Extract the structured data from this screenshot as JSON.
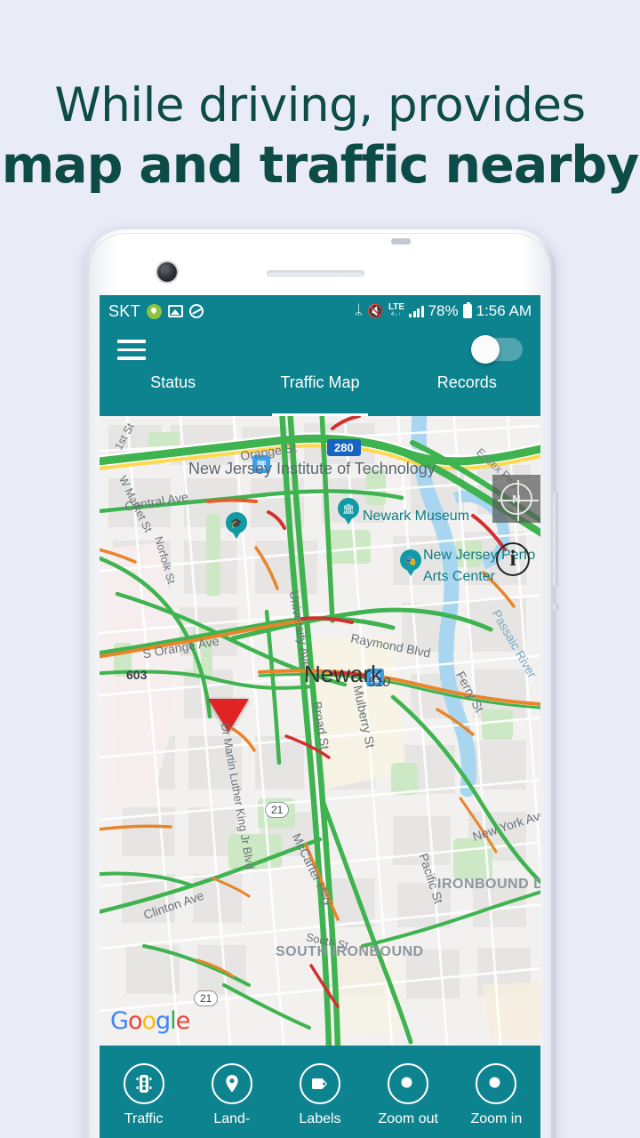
{
  "promo": {
    "line1": "While driving, provides",
    "line2": "map and traffic nearby",
    "text_color": "#0d4b46",
    "background_color": "#e9ebf7"
  },
  "theme": {
    "primary_teal": "#0d8390",
    "accent_white": "#ffffff",
    "map_marker_red": "#e02424",
    "poi_teal": "#0f9aa4"
  },
  "statusbar": {
    "carrier": "SKT",
    "left_icons": [
      "location-pin-icon",
      "gallery-icon",
      "data-saver-icon"
    ],
    "bluetooth_icon": "ᛦ",
    "mute_icon": "🔇",
    "network_type": "LTE",
    "network_sub": "4↓↑",
    "battery_percent": "78%",
    "clock": "1:56 AM"
  },
  "appbar": {
    "menu_icon": "hamburger-icon",
    "toggle_state": "off",
    "tabs": [
      {
        "label": "Status",
        "active": false
      },
      {
        "label": "Traffic Map",
        "active": true
      },
      {
        "label": "Records",
        "active": false
      }
    ]
  },
  "map": {
    "attribution": "Google",
    "google_letters": [
      "G",
      "o",
      "o",
      "g",
      "l",
      "e"
    ],
    "compass_label": "N",
    "info_label": "i",
    "city_label": "Newark",
    "place_labels": [
      {
        "text": "New Jersey Institute of Technology",
        "type": "campus"
      },
      {
        "text": "Newark Museum",
        "type": "poi"
      },
      {
        "text": "New Jersey Perfo",
        "type": "poi"
      },
      {
        "text": "Arts Center",
        "type": "poi"
      }
    ],
    "district_labels": [
      "IRONBOUND DISTRICT",
      "SOUTH IRONBOUND"
    ],
    "street_labels": [
      "1st St",
      "Orange St",
      "Central Ave",
      "W Market St",
      "Norfolk St",
      "S Orange Ave",
      "University Ave",
      "Raymond Blvd",
      "Mulberry St",
      "Broad St",
      "Ferry St",
      "Passaic River",
      "Essex Fwy",
      "Dr Martin Luther King Jr Blvd",
      "Clinton Ave",
      "McCarter Hwy",
      "South St",
      "New York Ave",
      "Pacific St"
    ],
    "route_shields": [
      {
        "label": "280",
        "style": "interstate"
      },
      {
        "label": "603",
        "style": "plain"
      },
      {
        "label": "510",
        "style": "plain"
      },
      {
        "label": "21",
        "style": "oval"
      },
      {
        "label": "21",
        "style": "oval"
      }
    ],
    "transit_icons": 3
  },
  "toolbar": {
    "items": [
      {
        "label": "Traffic",
        "icon": "traffic-light-icon"
      },
      {
        "label": "Land-",
        "icon": "map-pin-icon"
      },
      {
        "label": "Labels",
        "icon": "tag-icon"
      },
      {
        "label": "Zoom out",
        "icon": "magnifier-minus-icon"
      },
      {
        "label": "Zoom in",
        "icon": "magnifier-plus-icon"
      }
    ]
  }
}
